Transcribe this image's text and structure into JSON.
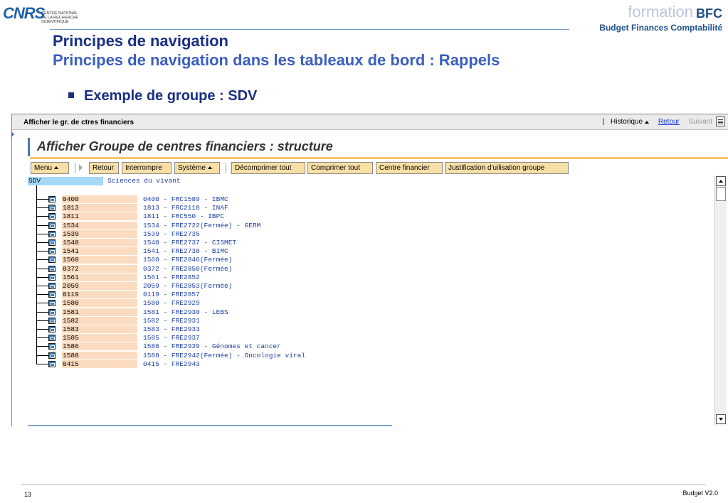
{
  "header": {
    "cnrs_mark": "CNRS",
    "cnrs_lines": [
      "CENTRE NATIONAL",
      "DE LA RECHERCHE",
      "SCIENTIFIQUE"
    ],
    "bfc_formation": "formation",
    "bfc_abbr": "BFC",
    "bfc_subtitle": "Budget Finances Comptabilité"
  },
  "slide": {
    "title": "Principes de navigation",
    "subtitle": "Principes de navigation dans les tableaux de bord : Rappels",
    "bullet": "Exemple de groupe : SDV"
  },
  "sap": {
    "window_title": "Afficher le gr. de ctres financiers",
    "nav": {
      "separator": "|",
      "historique": "Historique",
      "retour": "Retour",
      "suivant": "Suivant"
    },
    "heading": "Afficher Groupe de centres financiers : structure",
    "toolbar": {
      "menu": "Menu",
      "retour": "Retour",
      "interrompre": "Interrompre",
      "systeme": "Système",
      "decomprimer": "Décomprimer tout",
      "comprimer": "Comprimer tout",
      "centre_financier": "Centre financier",
      "justification": "Justification d'uilisation groupe"
    },
    "tree": {
      "root_key": "SDV",
      "root_text": "Sciences du vivant",
      "rows": [
        {
          "key": "0400",
          "text": "0400 - FRC1589 - IBMC"
        },
        {
          "key": "1813",
          "text": "1813 - FRC2118 - INAF"
        },
        {
          "key": "1811",
          "text": "1811 - FRC550 - IBPC"
        },
        {
          "key": "1534",
          "text": "1534 - FRE2722(Fermée) - GERM"
        },
        {
          "key": "1539",
          "text": "1539 - FRE2735"
        },
        {
          "key": "1540",
          "text": "1540 - FRE2737 - CISMET"
        },
        {
          "key": "1541",
          "text": "1541 - FRE2738 - BIMC"
        },
        {
          "key": "1560",
          "text": "1560 - FRE2846(Fermée)"
        },
        {
          "key": "0372",
          "text": "0372 - FRE2850(Fermée)"
        },
        {
          "key": "1561",
          "text": "1561 - FRE2852"
        },
        {
          "key": "2059",
          "text": "2059 - FRE2853(Fermée)"
        },
        {
          "key": "0119",
          "text": "0119 - FRE2857"
        },
        {
          "key": "1580",
          "text": "1580 - FRE2929"
        },
        {
          "key": "1581",
          "text": "1581 - FRE2930 - LEBS"
        },
        {
          "key": "1582",
          "text": "1582 - FRE2931"
        },
        {
          "key": "1583",
          "text": "1583 - FRE2933"
        },
        {
          "key": "1585",
          "text": "1585 - FRE2937"
        },
        {
          "key": "1586",
          "text": "1586 - FRE2939 - Génomes et cancer"
        },
        {
          "key": "1588",
          "text": "1588 - FRE2942(Fermée) - Oncologie viral"
        },
        {
          "key": "0415",
          "text": "0415 - FRE2943"
        }
      ]
    }
  },
  "footer": {
    "page_number": "13",
    "version": "Budget  V2.0"
  },
  "colors": {
    "title_dark_blue": "#1a2f84",
    "subtitle_blue": "#3b5fbf",
    "toolbar_button": "#f8dfa6",
    "tree_key_bg": "#fcdcc0",
    "root_key_bg": "#a6d9f7",
    "tree_text_blue": "#1f3fa3"
  }
}
